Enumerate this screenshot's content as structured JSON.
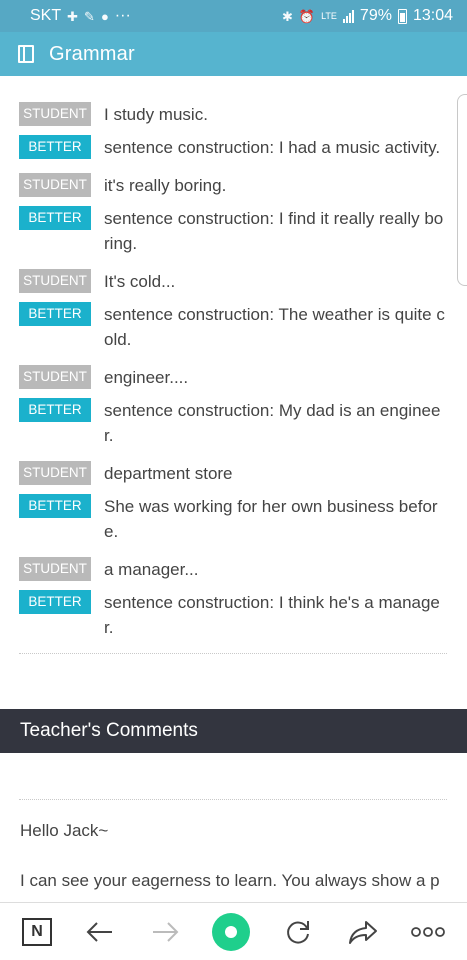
{
  "status_bar": {
    "carrier": "SKT",
    "network": "LTE",
    "battery": "79%",
    "time": "13:04",
    "more": "···"
  },
  "app_bar": {
    "title": "Grammar",
    "icon": "book-icon"
  },
  "grammar": {
    "student_label": "STUDENT",
    "better_label": "BETTER",
    "entries": [
      {
        "student": "I study music.",
        "better": "sentence construction: I had a music activity."
      },
      {
        "student": "it's really boring.",
        "better": "sentence construction: I find it really really boring."
      },
      {
        "student": "It's cold...",
        "better": "sentence construction: The weather is quite cold."
      },
      {
        "student": "engineer....",
        "better": "sentence construction: My dad is an engineer."
      },
      {
        "student": "department store",
        "better": "She was working for her own business before."
      },
      {
        "student": "a manager...",
        "better": "sentence construction: I think he's a manager."
      }
    ]
  },
  "comments": {
    "title": "Teacher's Comments",
    "greeting": "Hello Jack~",
    "body": "I can see your eagerness to learn. You always show a p"
  },
  "bottom_nav": {
    "n_label": "N",
    "icons": [
      "n-logo-icon",
      "back-arrow-icon",
      "forward-arrow-icon",
      "home-icon",
      "refresh-icon",
      "share-icon",
      "more-icon"
    ],
    "accent": "#1fcf8c"
  },
  "colors": {
    "header": "#56b4cf",
    "status": "#56a8c4",
    "student_tag": "#b9b9b9",
    "better_tag": "#1bb1cc",
    "section_bar": "#33353f"
  }
}
